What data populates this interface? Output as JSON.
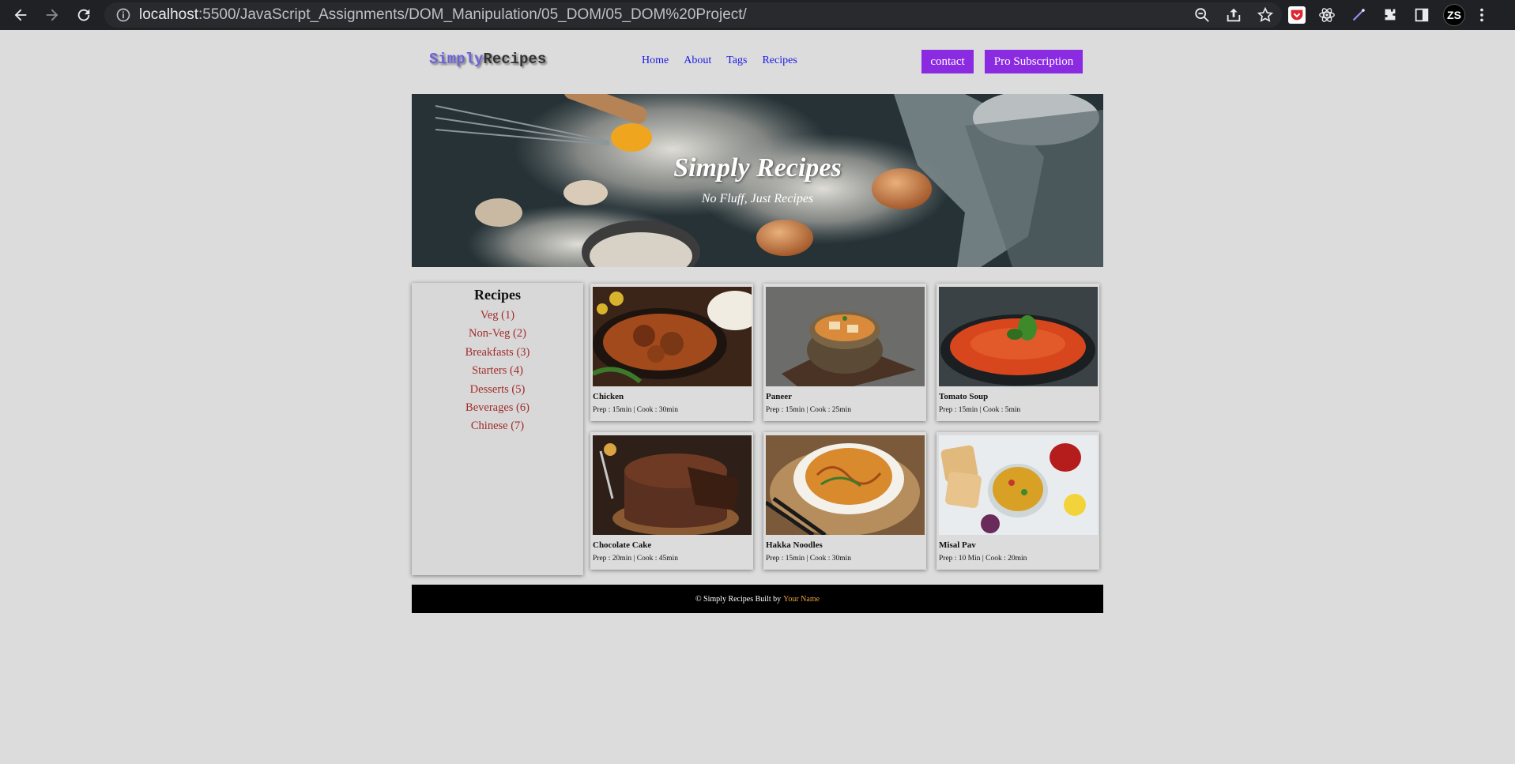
{
  "browser": {
    "url_host": "localhost",
    "url_path": ":5500/JavaScript_Assignments/DOM_Manipulation/05_DOM/05_DOM%20Project/",
    "profile_initials": "ZS"
  },
  "navbar": {
    "logo_part1": "Simply",
    "logo_part2": "Recipes",
    "links": [
      "Home",
      "About",
      "Tags",
      "Recipes"
    ],
    "contact_label": "contact",
    "pro_label": "Pro Subscription"
  },
  "hero": {
    "title": "Simply Recipes",
    "subtitle": "No Fluff, Just Recipes"
  },
  "sidebar": {
    "title": "Recipes",
    "items": [
      "Veg (1)",
      "Non-Veg (2)",
      "Breakfasts (3)",
      "Starters (4)",
      "Desserts (5)",
      "Beverages (6)",
      "Chinese (7)"
    ]
  },
  "recipes": [
    {
      "name": "Chicken",
      "meta": "Prep : 15min | Cook : 30min"
    },
    {
      "name": "Paneer",
      "meta": "Prep : 15min | Cook : 25min"
    },
    {
      "name": "Tomato Soup",
      "meta": "Prep : 15min | Cook : 5min"
    },
    {
      "name": "Chocolate Cake",
      "meta": "Prep : 20min | Cook : 45min"
    },
    {
      "name": "Hakka Noodles",
      "meta": "Prep : 15min | Cook : 30min"
    },
    {
      "name": "Misal Pav",
      "meta": "Prep : 10 Min | Cook : 20min"
    }
  ],
  "footer": {
    "text": "© Simply Recipes Built by",
    "author": "Your Name"
  },
  "colors": {
    "accent": "#8a2be2",
    "link": "#1a1ae6",
    "category": "#a32a2a",
    "footer_bg": "#000000",
    "footer_author": "#e8a23a"
  }
}
